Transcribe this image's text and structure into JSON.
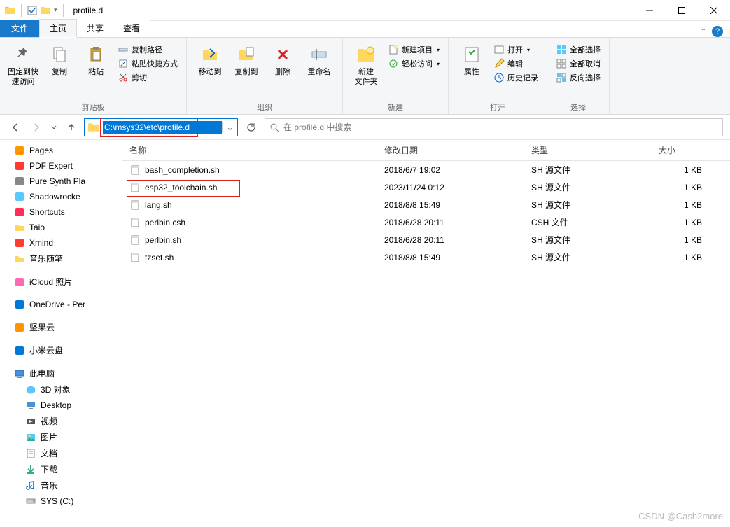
{
  "window": {
    "title": "profile.d"
  },
  "tabs": {
    "file": "文件",
    "home": "主页",
    "share": "共享",
    "view": "查看"
  },
  "ribbon": {
    "clipboard": {
      "label": "剪贴板",
      "pin": "固定到快\n速访问",
      "copy": "复制",
      "paste": "粘贴",
      "copyPath": "复制路径",
      "pasteShortcut": "粘贴快捷方式",
      "cut": "剪切"
    },
    "organize": {
      "label": "组织",
      "moveTo": "移动到",
      "copyTo": "复制到",
      "delete": "删除",
      "rename": "重命名"
    },
    "new_": {
      "label": "新建",
      "newFolder": "新建\n文件夹",
      "newItem": "新建项目",
      "easyAccess": "轻松访问"
    },
    "open": {
      "label": "打开",
      "properties": "属性",
      "open": "打开",
      "edit": "编辑",
      "history": "历史记录"
    },
    "select": {
      "label": "选择",
      "selectAll": "全部选择",
      "selectNone": "全部取消",
      "invert": "反向选择"
    }
  },
  "nav": {
    "path": "C:\\msys32\\etc\\profile.d",
    "searchPlaceholder": "在 profile.d 中搜索"
  },
  "sidebar": {
    "items": [
      {
        "label": "Pages",
        "icon": "pages",
        "color": "#ff9500"
      },
      {
        "label": "PDF Expert",
        "icon": "pdf",
        "color": "#ff3b30"
      },
      {
        "label": "Pure Synth Pla",
        "icon": "synth",
        "color": "#888"
      },
      {
        "label": "Shadowrocke",
        "icon": "rocket",
        "color": "#5ac8fa"
      },
      {
        "label": "Shortcuts",
        "icon": "shortcuts",
        "color": "#ff2d55"
      },
      {
        "label": "Taio",
        "icon": "folder",
        "color": "#ffcc00"
      },
      {
        "label": "Xmind",
        "icon": "xmind",
        "color": "#ff3b30"
      },
      {
        "label": "音乐随笔",
        "icon": "folder",
        "color": "#ffcc00"
      }
    ],
    "cloud": [
      {
        "label": "iCloud 照片",
        "icon": "icloud",
        "color": "#ff69b4"
      },
      {
        "label": "OneDrive - Per",
        "icon": "onedrive",
        "color": "#0078d4"
      },
      {
        "label": "坚果云",
        "icon": "nut",
        "color": "#ff9500"
      },
      {
        "label": "小米云盘",
        "icon": "mi",
        "color": "#0078d4"
      }
    ],
    "pc": {
      "label": "此电脑",
      "children": [
        {
          "label": "3D 对象",
          "icon": "3d"
        },
        {
          "label": "Desktop",
          "icon": "desktop"
        },
        {
          "label": "视频",
          "icon": "video"
        },
        {
          "label": "图片",
          "icon": "pictures"
        },
        {
          "label": "文档",
          "icon": "docs"
        },
        {
          "label": "下载",
          "icon": "downloads"
        },
        {
          "label": "音乐",
          "icon": "music"
        },
        {
          "label": "SYS (C:)",
          "icon": "disk"
        }
      ]
    }
  },
  "columns": {
    "name": "名称",
    "date": "修改日期",
    "type": "类型",
    "size": "大小"
  },
  "files": [
    {
      "name": "bash_completion.sh",
      "date": "2018/6/7 19:02",
      "type": "SH 源文件",
      "size": "1 KB",
      "hl": false
    },
    {
      "name": "esp32_toolchain.sh",
      "date": "2023/11/24 0:12",
      "type": "SH 源文件",
      "size": "1 KB",
      "hl": true
    },
    {
      "name": "lang.sh",
      "date": "2018/8/8 15:49",
      "type": "SH 源文件",
      "size": "1 KB",
      "hl": false
    },
    {
      "name": "perlbin.csh",
      "date": "2018/6/28 20:11",
      "type": "CSH 文件",
      "size": "1 KB",
      "hl": false
    },
    {
      "name": "perlbin.sh",
      "date": "2018/6/28 20:11",
      "type": "SH 源文件",
      "size": "1 KB",
      "hl": false
    },
    {
      "name": "tzset.sh",
      "date": "2018/8/8 15:49",
      "type": "SH 源文件",
      "size": "1 KB",
      "hl": false
    }
  ],
  "watermark": "CSDN @Cash2more"
}
